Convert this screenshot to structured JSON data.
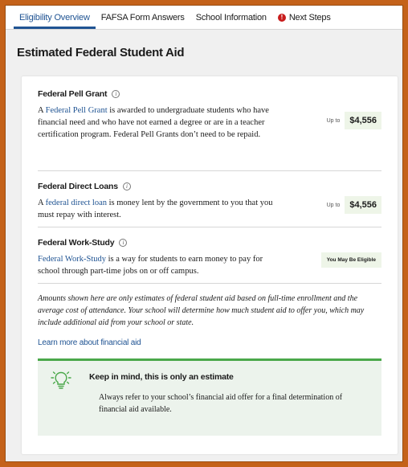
{
  "tabs": [
    {
      "label": "Eligibility Overview",
      "active": true
    },
    {
      "label": "FAFSA Form Answers",
      "active": false
    },
    {
      "label": "School Information",
      "active": false
    },
    {
      "label": "Next Steps",
      "active": false,
      "icon": "alert-icon"
    }
  ],
  "page_title": "Estimated Federal Student Aid",
  "aid": {
    "pell": {
      "title": "Federal Pell Grant",
      "desc_prefix": "A ",
      "link": "Federal Pell Grant",
      "desc_suffix": " is awarded to undergraduate students who have financial need and who have not earned a degree or are in a teacher certification program. Federal Pell Grants don’t need to be repaid.",
      "upto": "Up to",
      "amount": "$4,556"
    },
    "loans": {
      "title": "Federal Direct Loans",
      "desc_prefix": "A ",
      "link": "federal direct loan",
      "desc_suffix": " is money lent by the government to you that you must repay with interest.",
      "upto": "Up to",
      "amount": "$4,556"
    },
    "workstudy": {
      "title": "Federal Work-Study",
      "link": "Federal Work-Study",
      "desc_suffix": " is a way for students to earn money to pay for school through part-time jobs on or off campus.",
      "status": "You May Be Eligible"
    }
  },
  "disclaimer": "Amounts shown here are only estimates of federal student aid based on full-time enrollment and the average cost of attendance. Your school will determine how much student aid to offer you, which may include additional aid from your school or state.",
  "learn_more": "Learn more about financial aid",
  "callout": {
    "title": "Keep in mind, this is only an estimate",
    "text": "Always refer to your school’s financial aid offer for a final determination of financial aid available.",
    "icon": "lightbulb-icon",
    "accent": "#4aa84a"
  },
  "colors": {
    "link": "#205493",
    "frame": "#c4621a",
    "amount_bg": "#eef5e8",
    "alert": "#c81c1c"
  }
}
